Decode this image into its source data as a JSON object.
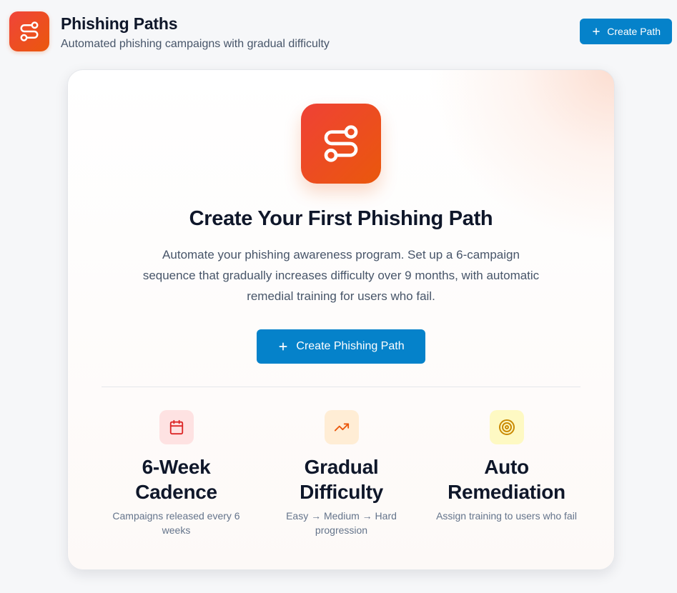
{
  "header": {
    "title": "Phishing Paths",
    "subtitle": "Automated phishing campaigns with gradual difficulty",
    "create_button_label": "Create Path"
  },
  "empty_state": {
    "title": "Create Your First Phishing Path",
    "description": "Automate your phishing awareness program. Set up a 6-campaign sequence that gradually increases difficulty over 9 months, with automatic remedial training for users who fail.",
    "button_label": "Create Phishing Path"
  },
  "features": [
    {
      "icon": "calendar-icon",
      "title": "6-Week Cadence",
      "description": "Campaigns released every 6 weeks",
      "icon_bg": "#fee2e2",
      "icon_color": "#dc2626"
    },
    {
      "icon": "trending-up-icon",
      "title": "Gradual Difficulty",
      "description": "Easy → Medium → Hard progression",
      "icon_bg": "#ffedd5",
      "icon_color": "#ea580c"
    },
    {
      "icon": "target-icon",
      "title": "Auto Remediation",
      "description": "Assign training to users who fail",
      "icon_bg": "#fef9c3",
      "icon_color": "#ca8a04"
    }
  ],
  "colors": {
    "accent": "#0582ca",
    "brand_gradient_start": "#ef4136",
    "brand_gradient_end": "#ea580c"
  }
}
